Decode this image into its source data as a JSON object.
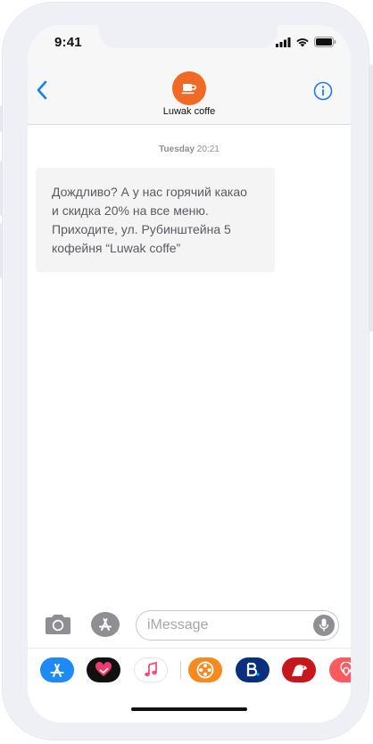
{
  "status_bar": {
    "time": "9:41"
  },
  "header": {
    "back_icon": "chevron-left-icon",
    "contact_name": "Luwak coffe",
    "avatar_icon": "coffee-cup-icon",
    "info_icon": "info-icon"
  },
  "conversation": {
    "timestamp_day": "Tuesday",
    "timestamp_time": "20:21",
    "messages": [
      {
        "direction": "incoming",
        "text": "Дождливо? А у нас горячий какао\nи скидка 20% на все меню.\nПриходите, ул. Рубинштейна 5\nкофейня “Luwak coffe”"
      }
    ]
  },
  "compose": {
    "placeholder": "iMessage",
    "value": ""
  },
  "app_drawer": {
    "apps": [
      "app-store-icon",
      "heart-app-icon",
      "music-icon",
      "film-reel-icon",
      "booking-icon",
      "dog-app-icon",
      "airbnb-icon"
    ]
  },
  "colors": {
    "accent": "#1a7cf0",
    "avatar_bg": "#f06a25",
    "bubble_bg": "#f4f4f5",
    "header_bg": "#f7f7f8"
  }
}
